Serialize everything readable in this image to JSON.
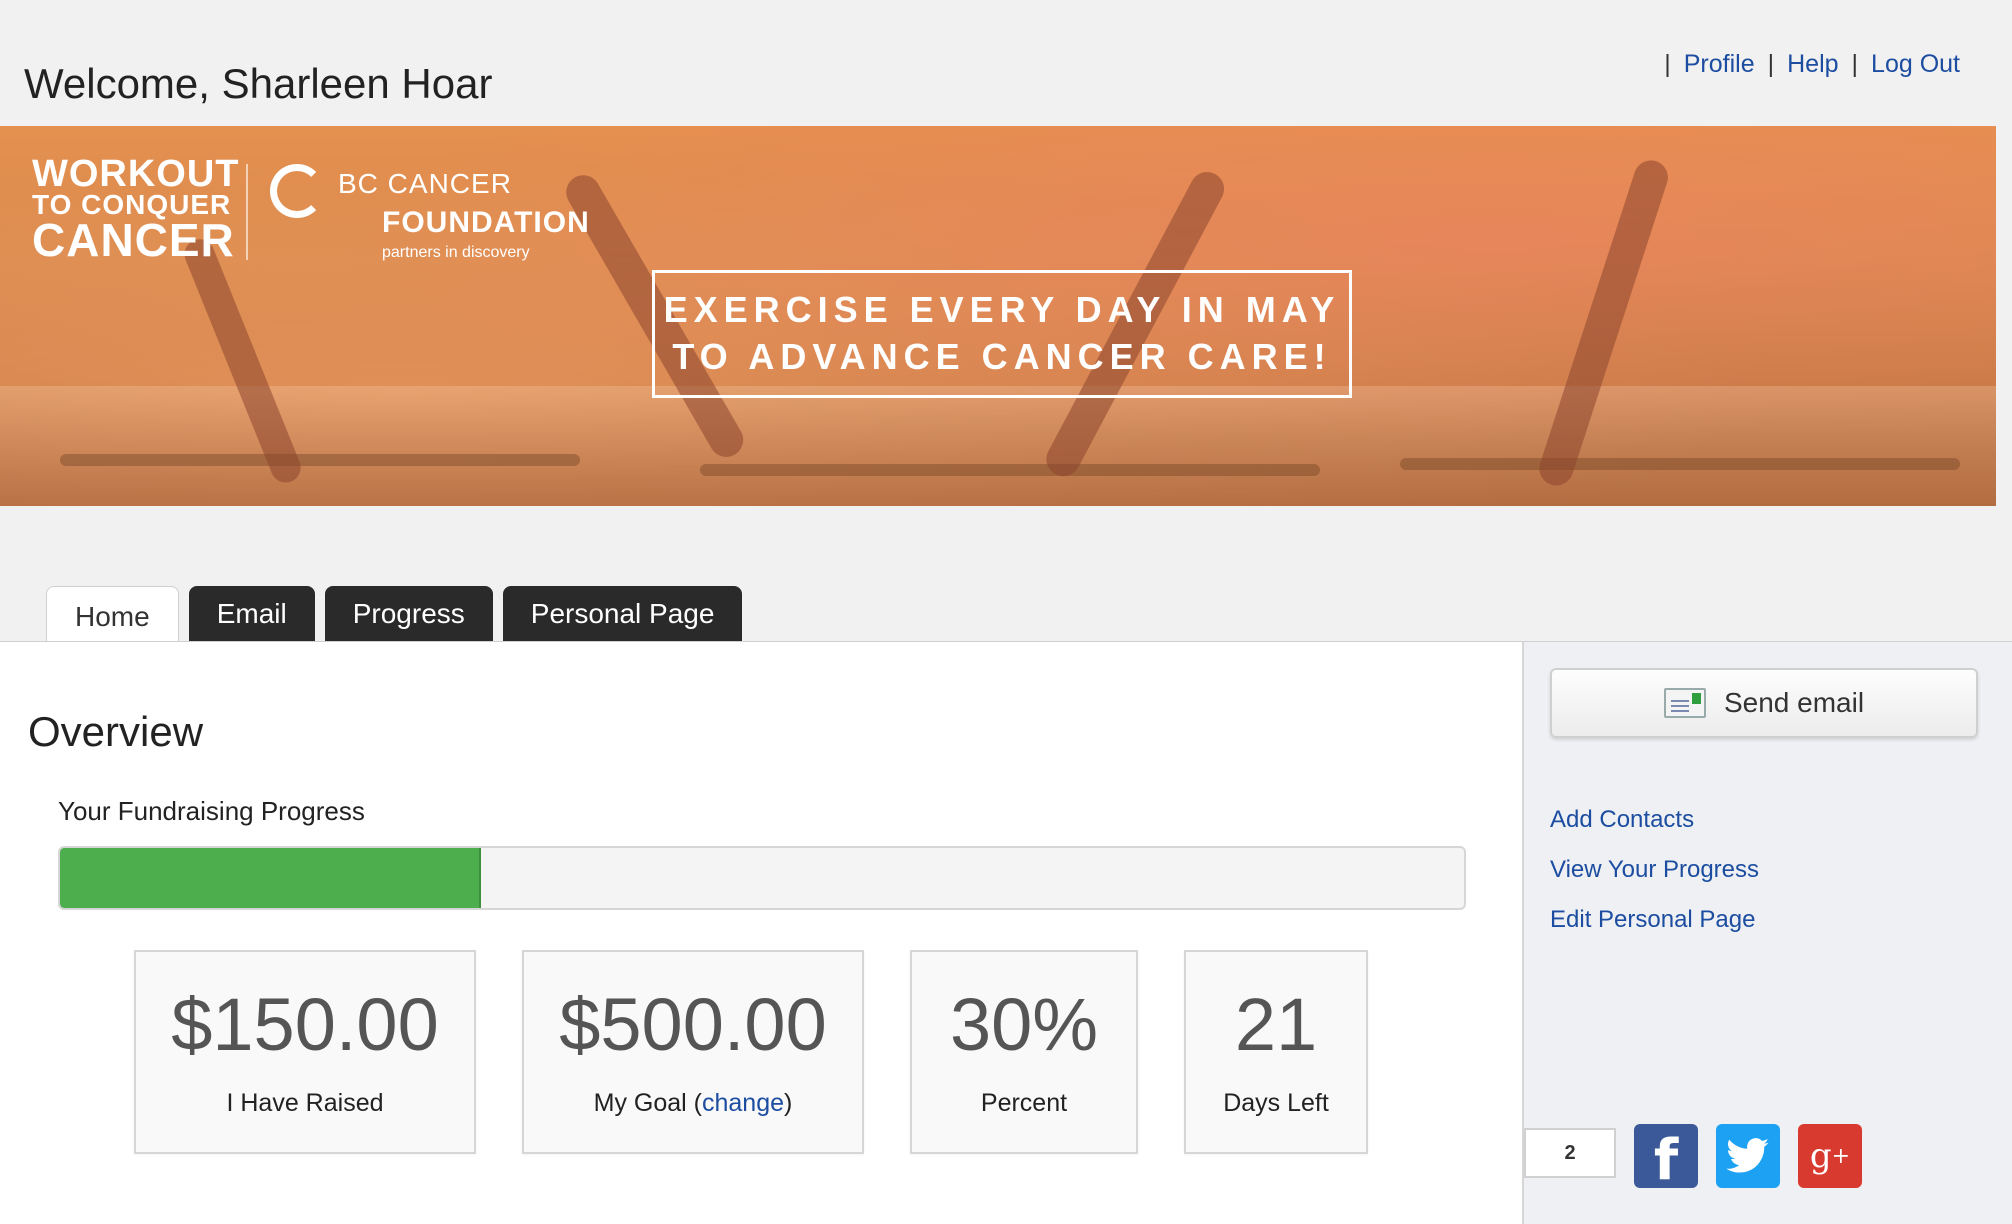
{
  "header": {
    "welcome": "Welcome, Sharleen Hoar",
    "nav": [
      {
        "label": "Profile"
      },
      {
        "label": "Help"
      },
      {
        "label": "Log Out"
      }
    ],
    "separator": "|"
  },
  "banner": {
    "logo_line1": "WORKOUT",
    "logo_line2": "TO CONQUER",
    "logo_line3": "CANCER",
    "foundation_line1": "BC CANCER",
    "foundation_line2": "FOUNDATION",
    "foundation_tagline": "partners in discovery",
    "slogan_line1": "EXERCISE EVERY DAY IN MAY",
    "slogan_line2": "TO ADVANCE CANCER CARE!"
  },
  "tabs": [
    {
      "label": "Home",
      "active": true
    },
    {
      "label": "Email"
    },
    {
      "label": "Progress"
    },
    {
      "label": "Personal Page"
    }
  ],
  "main": {
    "title": "Overview",
    "progress_label": "Your Fundraising Progress",
    "progress_fraction": 0.3,
    "stats": [
      {
        "value": "$150.00",
        "label": "I Have Raised"
      },
      {
        "value": "$500.00",
        "label_prefix": "My Goal (",
        "link": "change",
        "label_suffix": ")"
      },
      {
        "value": "30%",
        "label": "Percent"
      },
      {
        "value": "21",
        "label": "Days Left"
      }
    ]
  },
  "sidebar": {
    "send_email": "Send email",
    "links": [
      "Add Contacts",
      "View Your Progress",
      "Edit Personal Page"
    ],
    "share_count": "2",
    "social_icons": [
      "facebook-icon",
      "twitter-icon",
      "google-plus-icon"
    ]
  },
  "colors": {
    "link": "#1c4da1",
    "progress": "#4cae4c",
    "tab_dark": "#2a2a2a",
    "facebook": "#3b5998",
    "twitter": "#1da1f2",
    "google_plus": "#d93a2f"
  }
}
